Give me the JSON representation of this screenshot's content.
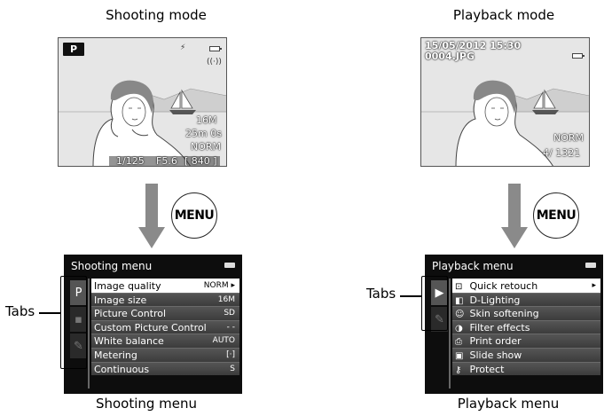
{
  "left": {
    "mode_title": "Shooting mode",
    "screen": {
      "mode_badge": "P",
      "flash_icon": "flash-auto-icon",
      "battery_icon": "battery-icon",
      "vr_icon": "vibration-reduction-icon",
      "image_size": "16M",
      "time_remaining": "25m 0s",
      "quality": "NORM",
      "shutter_speed": "1/125",
      "aperture": "F5.6",
      "exposures_remaining": "[ 840 ]"
    },
    "menu_button_label": "MENU",
    "menu": {
      "title": "Shooting menu",
      "tabs": [
        {
          "label": "P",
          "icon": "shooting-mode-tab-icon"
        },
        {
          "label": "",
          "icon": "movie-tab-icon"
        },
        {
          "label": "",
          "icon": "setup-tab-icon"
        }
      ],
      "items": [
        {
          "label": "Image quality",
          "value": "NORM ▸"
        },
        {
          "label": "Image size",
          "value": "16M"
        },
        {
          "label": "Picture Control",
          "value": "SD"
        },
        {
          "label": "Custom Picture Control",
          "value": "- -"
        },
        {
          "label": "White balance",
          "value": "AUTO"
        },
        {
          "label": "Metering",
          "value": "[·]"
        },
        {
          "label": "Continuous",
          "value": "S"
        }
      ]
    },
    "tabs_label": "Tabs",
    "caption": "Shooting menu"
  },
  "right": {
    "mode_title": "Playback mode",
    "screen": {
      "datetime": "15/05/2012 15:30",
      "filename": "0004.JPG",
      "battery_icon": "battery-icon",
      "quality": "NORM",
      "counter": "4/ 1321"
    },
    "menu_button_label": "MENU",
    "menu": {
      "title": "Playback menu",
      "tabs": [
        {
          "label": "▶",
          "icon": "playback-tab-icon"
        },
        {
          "label": "",
          "icon": "setup-tab-icon"
        }
      ],
      "items": [
        {
          "label": "Quick retouch",
          "icon": "quick-retouch-icon",
          "value": "▸"
        },
        {
          "label": "D-Lighting",
          "icon": "d-lighting-icon",
          "value": ""
        },
        {
          "label": "Skin softening",
          "icon": "skin-softening-icon",
          "value": ""
        },
        {
          "label": "Filter effects",
          "icon": "filter-effects-icon",
          "value": ""
        },
        {
          "label": "Print order",
          "icon": "print-order-icon",
          "value": ""
        },
        {
          "label": "Slide show",
          "icon": "slide-show-icon",
          "value": ""
        },
        {
          "label": "Protect",
          "icon": "protect-key-icon",
          "value": ""
        }
      ]
    },
    "tabs_label": "Tabs",
    "caption": "Playback menu"
  }
}
